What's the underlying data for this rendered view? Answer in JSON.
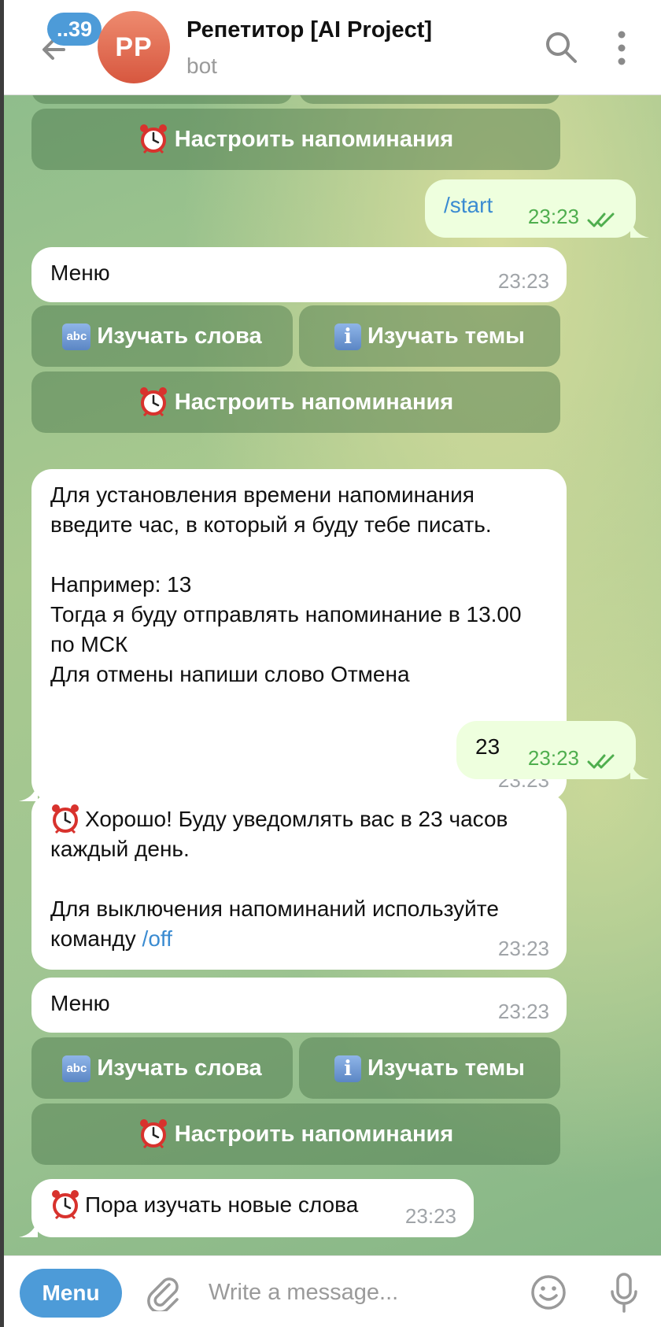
{
  "header": {
    "unread_badge": "..39",
    "avatar_initials": "PP",
    "title": "Репетитор [AI Project]",
    "subtitle": "bot"
  },
  "keyboard": {
    "learn_words": "Изучать слова",
    "learn_topics": "Изучать темы",
    "set_reminders": "Настроить напоминания",
    "abc_icon_text": "abc",
    "info_icon_text": "i"
  },
  "messages": {
    "start_cmd": {
      "text": "/start",
      "time": "23:23"
    },
    "menu_1": {
      "text": "Меню",
      "time": "23:23"
    },
    "reminder_prompt": {
      "line1": "Для установления времени напоминания",
      "line2": "введите час, в который я буду тебе писать.",
      "line3": "Например: 13",
      "line4": "Тогда я буду отправлять напоминание в 13.00",
      "line5": "по МСК",
      "line6": "Для отмены напиши слово Отмена",
      "time": "23:23"
    },
    "user_hour": {
      "text": "23",
      "time": "23:23"
    },
    "confirm": {
      "line1": "Хорошо! Буду уведомлять вас в 23 часов",
      "line2": "каждый день.",
      "line3": "Для выключения напоминаний используйте",
      "line4_prefix": "команду ",
      "line4_link": "/off",
      "time": "23:23"
    },
    "menu_2": {
      "text": "Меню",
      "time": "23:23"
    },
    "study_now": {
      "text": "Пора изучать новые слова",
      "time": "23:23"
    }
  },
  "input": {
    "menu_label": "Menu",
    "placeholder": "Write a message..."
  },
  "colors": {
    "accent": "#4d9bd8",
    "outgoing_bubble": "#eeffde",
    "read_check": "#4fae4e",
    "link": "#3a8bd1"
  },
  "icons": [
    "back-arrow-icon",
    "search-icon",
    "more-vert-icon",
    "double-check-icon",
    "alarm-clock-icon",
    "abc-icon",
    "info-icon",
    "paperclip-icon",
    "smile-icon",
    "microphone-icon"
  ]
}
